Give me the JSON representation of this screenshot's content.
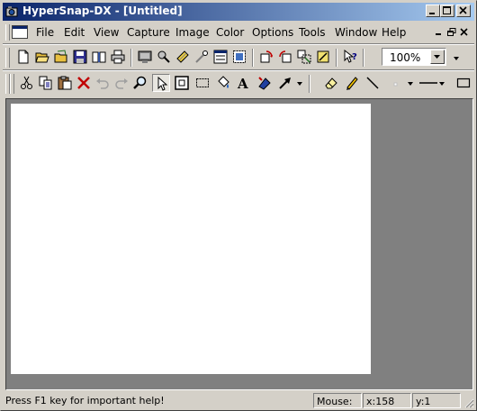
{
  "window": {
    "title": "HyperSnap-DX - [Untitled]"
  },
  "menu": {
    "items": [
      "File",
      "Edit",
      "View",
      "Capture",
      "Image",
      "Color",
      "Options",
      "Tools",
      "Window",
      "Help"
    ]
  },
  "toolbar": {
    "zoom_value": "100%"
  },
  "icons": {
    "toolbar1": [
      "new-icon",
      "open-icon",
      "open-folder-icon",
      "save-icon",
      "open-book-icon",
      "print-icon",
      "capture-screen-icon",
      "capture-tool-icon",
      "capture-scroll-icon",
      "capture-object-icon",
      "capture-region-icon",
      "capture-extended-icon",
      "rotate-icon",
      "undo-capture-icon",
      "resize-icon",
      "crop-icon",
      "context-help-icon"
    ],
    "toolbar2": [
      "cut-icon",
      "copy-icon",
      "paste-icon",
      "delete-icon",
      "undo-icon",
      "redo-icon",
      "zoom-icon",
      "select-arrow-icon",
      "select-window-icon",
      "select-rect-icon",
      "fill-icon",
      "text-icon",
      "stamp-icon",
      "arrow-tool-icon",
      "eraser-icon",
      "pencil-icon",
      "line-icon",
      "line-color-icon",
      "line-width-icon",
      "rectangle-icon"
    ]
  },
  "status": {
    "message": "Press F1 key for important help!",
    "mouse_label": "Mouse:",
    "x_readout": "x:158",
    "y_readout": "y:1"
  },
  "colors": {
    "title_start": "#0a246a",
    "title_end": "#a6caf0",
    "chrome": "#d4d0c8",
    "workspace": "#808080",
    "canvas": "#ffffff"
  }
}
